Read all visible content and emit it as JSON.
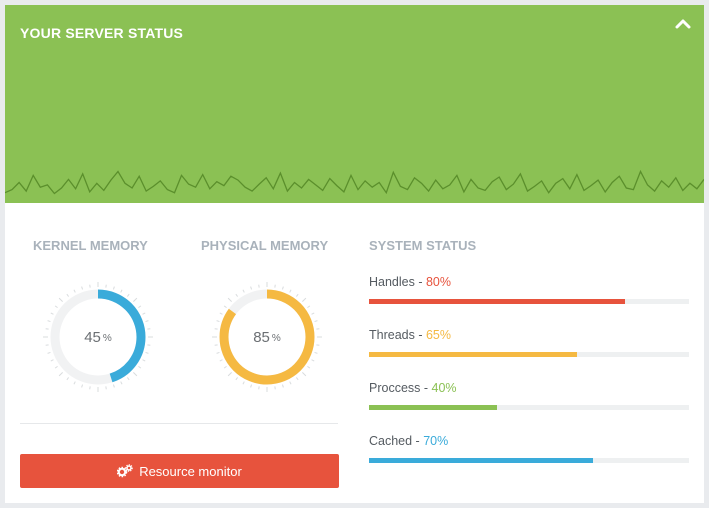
{
  "header": {
    "title": "YOUR SERVER STATUS",
    "collapse_icon": "chevron-up-icon",
    "background": "#8bc154",
    "sparkline": [
      62,
      58,
      49,
      60,
      40,
      55,
      52,
      63,
      56,
      45,
      57,
      38,
      61,
      50,
      59,
      46,
      35,
      50,
      56,
      41,
      60,
      54,
      47,
      58,
      62,
      40,
      51,
      55,
      39,
      57,
      48,
      53,
      41,
      46,
      55,
      60,
      51,
      43,
      57,
      37,
      60,
      49,
      56,
      45,
      52,
      59,
      44,
      53,
      61,
      40,
      58,
      47,
      55,
      49,
      62,
      36,
      54,
      58,
      43,
      50,
      60,
      46,
      57,
      52,
      40,
      61,
      45,
      56,
      59,
      48,
      42,
      58,
      51,
      38,
      60,
      54,
      47,
      62,
      50,
      44,
      57,
      39,
      59,
      53,
      46,
      61,
      49,
      41,
      56,
      58,
      35,
      52,
      60,
      47,
      55,
      43,
      59,
      50,
      57,
      45
    ]
  },
  "kernel": {
    "title": "KERNEL MEMORY",
    "value": "45",
    "unit": "%",
    "percent": 45,
    "color": "#3aabda"
  },
  "physical": {
    "title": "PHYSICAL MEMORY",
    "value": "85",
    "unit": "%",
    "percent": 85,
    "color": "#f5b942"
  },
  "system": {
    "title": "SYSTEM STATUS",
    "items": [
      {
        "label": "Handles - ",
        "value": "80%",
        "percent": 80,
        "color": "#e7533d"
      },
      {
        "label": "Threads - ",
        "value": "65%",
        "percent": 65,
        "color": "#f5b942"
      },
      {
        "label": "Proccess - ",
        "value": "40%",
        "percent": 40,
        "color": "#8bc154"
      },
      {
        "label": "Cached - ",
        "value": "70%",
        "percent": 70,
        "color": "#3aabda"
      }
    ]
  },
  "monitor_button": {
    "label": "Resource monitor",
    "icon": "gears-icon",
    "color": "#e7533d"
  }
}
